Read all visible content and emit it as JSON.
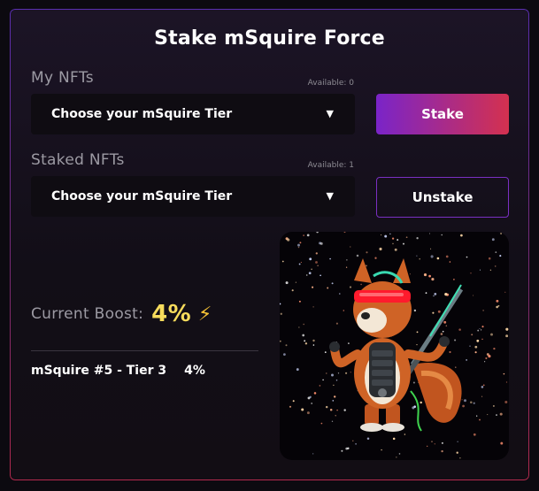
{
  "title": "Stake mSquire Force",
  "my_nfts": {
    "label": "My NFTs",
    "available": "Available: 0",
    "select_value": "Choose your mSquire Tier",
    "button": "Stake"
  },
  "staked_nfts": {
    "label": "Staked NFTs",
    "available": "Available: 1",
    "select_value": "Choose your mSquire Tier",
    "button": "Unstake"
  },
  "boost": {
    "label": "Current Boost:",
    "value": "4%",
    "icon": "lightning-icon"
  },
  "staked_list": [
    {
      "name": "mSquire #5 - Tier 3",
      "boost": "4%"
    }
  ],
  "nft_image": {
    "subject": "squirrel-knight-icon"
  },
  "colors": {
    "accent_start": "#7a24c8",
    "accent_end": "#d4314f",
    "boost": "#f7dc5c"
  }
}
